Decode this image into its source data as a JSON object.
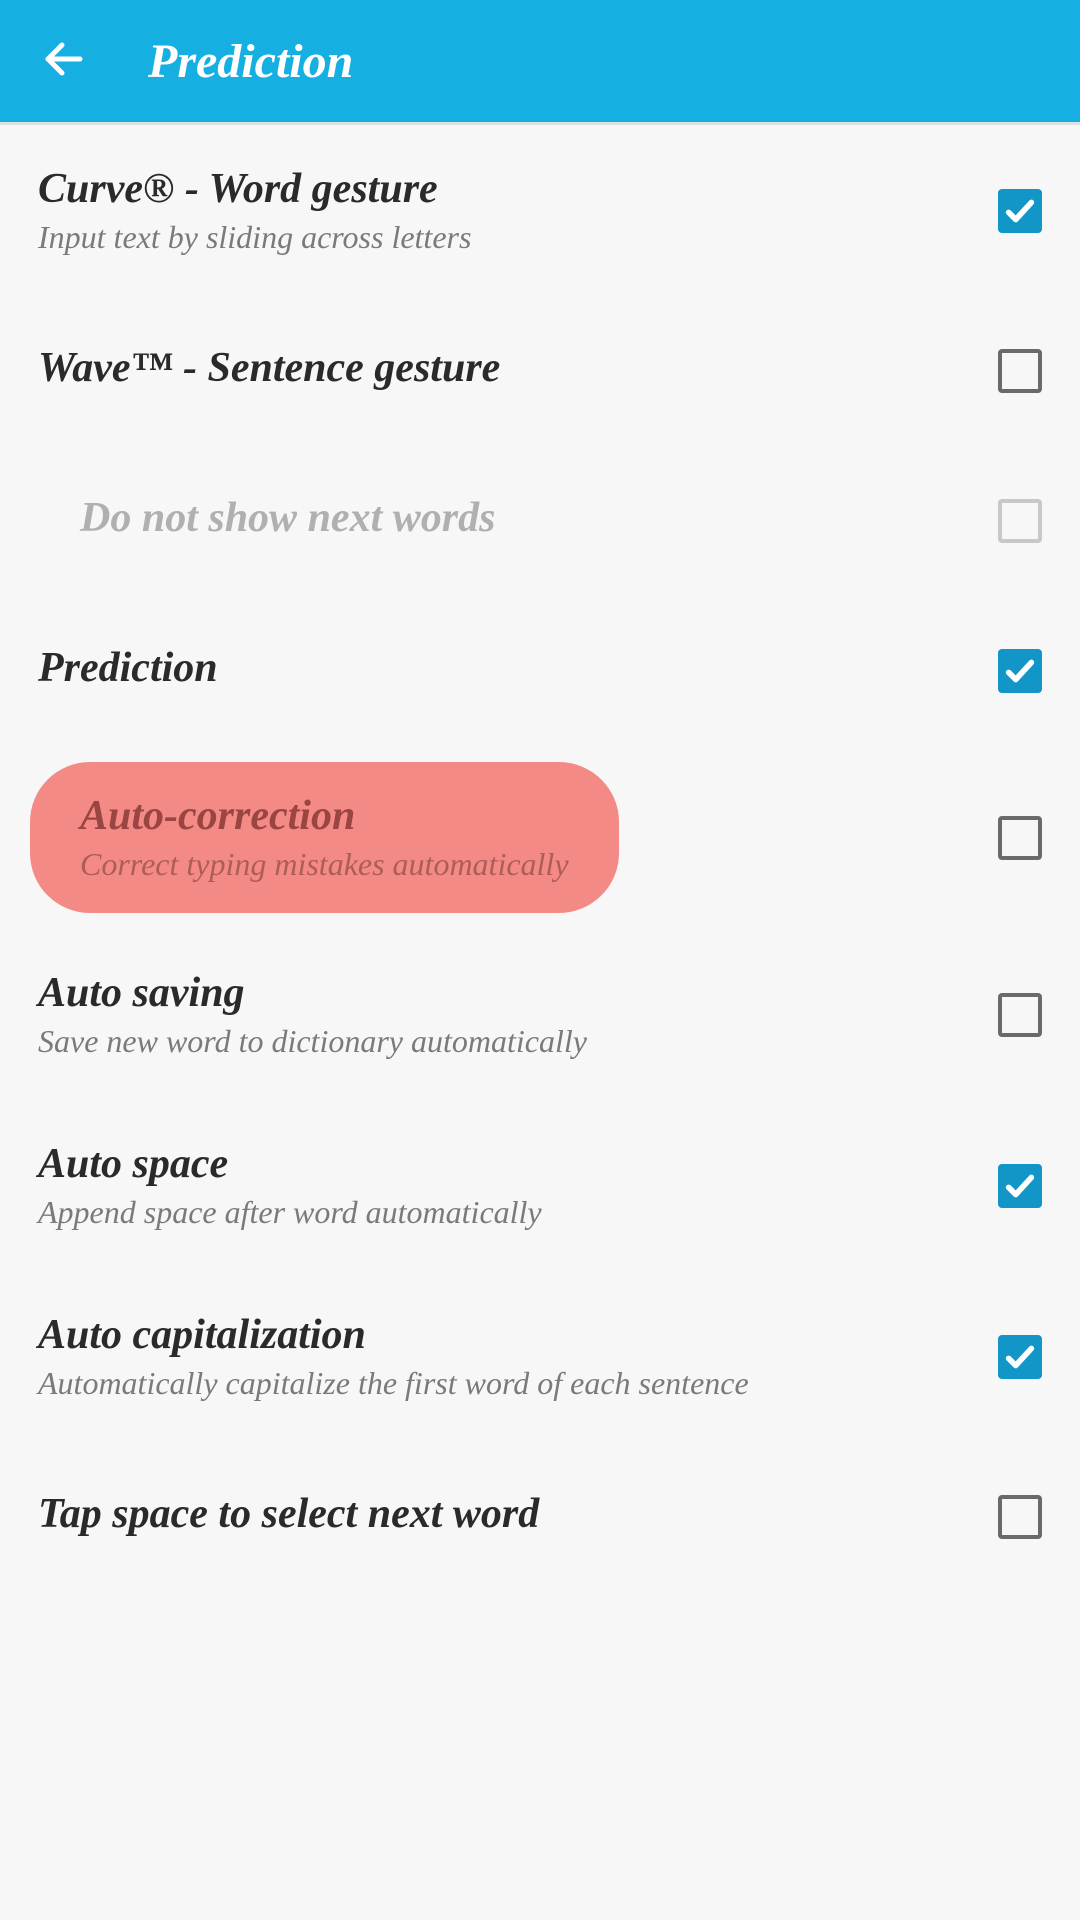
{
  "header": {
    "title": "Prediction"
  },
  "settings": [
    {
      "title": "Curve® - Word gesture",
      "subtitle": "Input text by sliding across letters",
      "checked": true,
      "disabled": false,
      "indented": false,
      "highlight": false
    },
    {
      "title": "Wave™ - Sentence gesture",
      "subtitle": "",
      "checked": false,
      "disabled": false,
      "indented": false,
      "highlight": false
    },
    {
      "title": "Do not show next words",
      "subtitle": "",
      "checked": false,
      "disabled": true,
      "indented": true,
      "highlight": false
    },
    {
      "title": "Prediction",
      "subtitle": "",
      "checked": true,
      "disabled": false,
      "indented": false,
      "highlight": false
    },
    {
      "title": "Auto-correction",
      "subtitle": "Correct typing mistakes automatically",
      "checked": false,
      "disabled": false,
      "indented": true,
      "highlight": true
    },
    {
      "title": "Auto saving",
      "subtitle": "Save new word to dictionary automatically",
      "checked": false,
      "disabled": false,
      "indented": false,
      "highlight": false
    },
    {
      "title": "Auto space",
      "subtitle": "Append space after word automatically",
      "checked": true,
      "disabled": false,
      "indented": false,
      "highlight": false
    },
    {
      "title": "Auto capitalization",
      "subtitle": "Automatically capitalize the first word of each sentence",
      "checked": true,
      "disabled": false,
      "indented": false,
      "highlight": false
    },
    {
      "title": "Tap space to select next word",
      "subtitle": "",
      "checked": false,
      "disabled": false,
      "indented": false,
      "highlight": false
    }
  ]
}
